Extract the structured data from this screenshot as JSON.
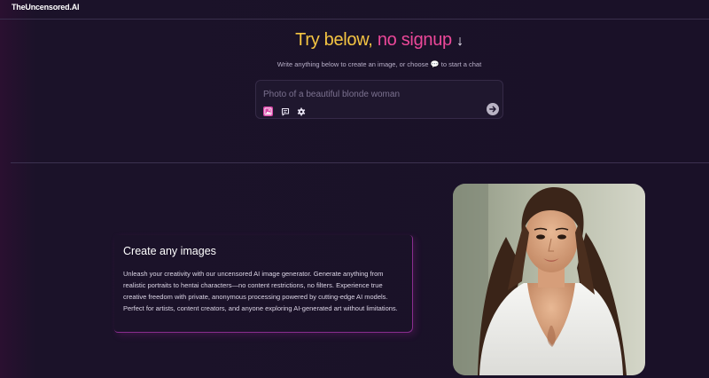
{
  "brand": {
    "logo": "TheUncensored.AI"
  },
  "hero": {
    "title_part1": "Try below,",
    "title_part2": "no signup",
    "title_arrow": "↓",
    "subtitle_before": "Write anything below to create an image, or choose",
    "subtitle_icon": "💬",
    "subtitle_after": "to start a chat",
    "prompt_placeholder": "Photo of a beautiful blonde woman",
    "tools": [
      "image-icon",
      "chat-icon",
      "gear-icon"
    ],
    "send_icon": "arrow-right-circle-icon"
  },
  "feature": {
    "title": "Create any images",
    "description": "Unleash your creativity with our uncensored AI image generator. Generate anything from realistic portraits to hentai characters—no content restrictions, no filters. Experience true creative freedom with private, anonymous processing powered by cutting-edge AI models. Perfect for artists, content creators, and anyone exploring AI-generated art without limitations."
  },
  "colors": {
    "background": "#1a1128",
    "title_yellow": "#f5c542",
    "title_pink": "#ec4899",
    "accent_magenta": "#d946a8",
    "card_border": "#8a2d8f"
  }
}
